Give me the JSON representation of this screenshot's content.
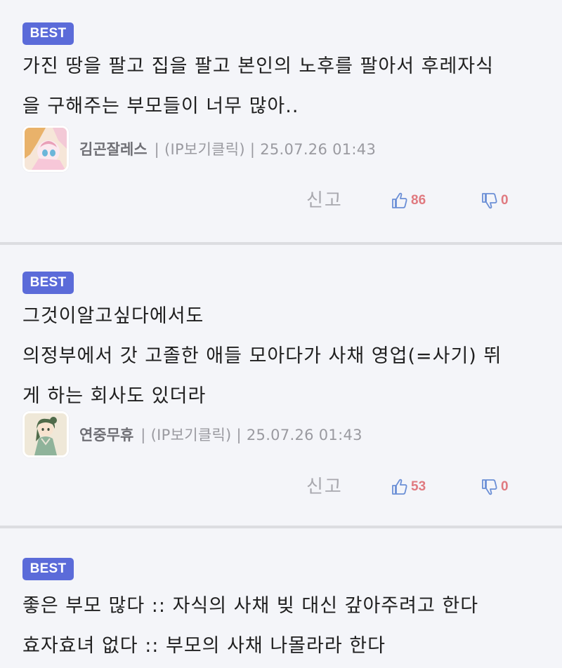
{
  "comments": [
    {
      "badge": "BEST",
      "lines": [
        "가진 땅을 팔고 집을 팔고 본인의 노후를 팔아서 후레자식",
        "을 구해주는 부모들이 너무 많아.."
      ],
      "author": "김곤잘레스",
      "info": "| (IP보기클릭) | 25.07.26 01:43",
      "report_label": "신고",
      "likes": "86",
      "dislikes": "0"
    },
    {
      "badge": "BEST",
      "lines": [
        "그것이알고싶다에서도",
        "의정부에서 갓 고졸한 애들 모아다가 사채 영업(=사기) 뛰",
        "게 하는 회사도 있더라"
      ],
      "author": "연중무휴",
      "info": "| (IP보기클릭) | 25.07.26 01:43",
      "report_label": "신고",
      "likes": "53",
      "dislikes": "0"
    },
    {
      "badge": "BEST",
      "lines": [
        "좋은 부모 많다 :: 자식의 사채 빚 대신 갚아주려고 한다",
        "효자효녀 없다 :: 부모의 사채 나몰라라 한다"
      ]
    }
  ],
  "colors": {
    "badge_bg": "#5b6bd9",
    "accent_blue": "#6b8fd6",
    "count_red": "#e07a80",
    "background": "#f4f5f9",
    "divider": "#dcdde1"
  },
  "icons": {
    "like": "thumbs-up-icon",
    "dislike": "thumbs-down-icon"
  }
}
